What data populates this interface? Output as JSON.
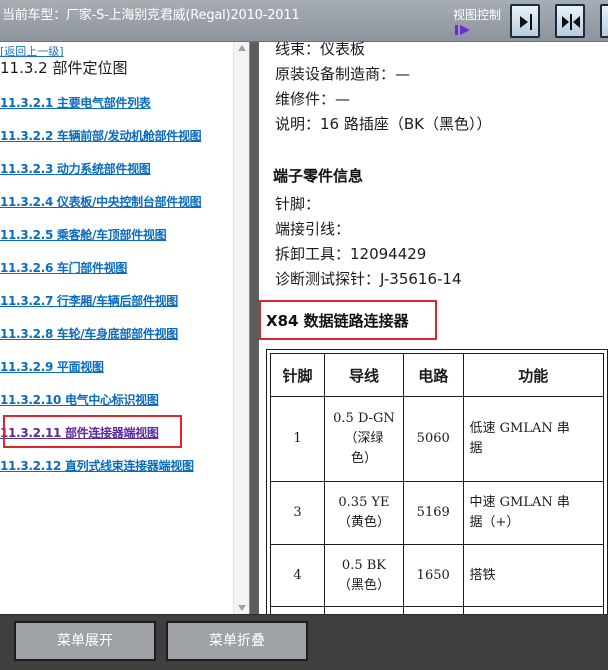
{
  "header": {
    "vehicle_label": "当前车型：厂家-S-上海别克君威(Regal)2010-2011",
    "view_control_label": "视图控制"
  },
  "sidebar": {
    "back_link": "[返回上一级]",
    "section_title": "11.3.2 部件定位图",
    "items": [
      {
        "label": "11.3.2.1 主要电气部件列表"
      },
      {
        "label": "11.3.2.2 车辆前部/发动机舱部件视图"
      },
      {
        "label": "11.3.2.3 动力系统部件视图"
      },
      {
        "label": "11.3.2.4 仪表板/中央控制台部件视图"
      },
      {
        "label": "11.3.2.5 乘客舱/车顶部件视图"
      },
      {
        "label": "11.3.2.6 车门部件视图"
      },
      {
        "label": "11.3.2.7 行李厢/车辆后部件视图"
      },
      {
        "label": "11.3.2.8 车轮/车身底部部件视图"
      },
      {
        "label": "11.3.2.9 平面视图"
      },
      {
        "label": "11.3.2.10 电气中心标识视图"
      },
      {
        "label": "11.3.2.11 部件连接器端视图"
      },
      {
        "label": "11.3.2.12 直列式线束连接器端视图"
      }
    ]
  },
  "content": {
    "info_lines": [
      "线束：仪表板",
      "原装设备制造商：—",
      "维修件：—",
      "说明：16 路插座（BK（黑色））"
    ],
    "terminal_heading": "端子零件信息",
    "terminal_lines": [
      "针脚：",
      "端接引线：",
      "拆卸工具：12094429",
      "诊断测试探针：J-35616-14"
    ],
    "connector_title": "X84 数据链路连接器",
    "table": {
      "headers": [
        "针脚",
        "导线",
        "电路",
        "功能"
      ],
      "rows": [
        {
          "pin": "1",
          "wire_1": "0.5 D-GN",
          "wire_2": "（深绿",
          "wire_3": "色）",
          "circuit": "5060",
          "func_1": "低速 GMLAN 串",
          "func_2": "据"
        },
        {
          "pin": "3",
          "wire_1": "0.35 YE",
          "wire_2": "（黄色）",
          "wire_3": "",
          "circuit": "5169",
          "func_1": "中速 GMLAN 串",
          "func_2": "据（+）"
        },
        {
          "pin": "4",
          "wire_1": "0.5 BK",
          "wire_2": "（黑色）",
          "wire_3": "",
          "circuit": "1650",
          "func_1": "搭铁",
          "func_2": ""
        }
      ]
    }
  },
  "footer": {
    "expand_label": "菜单展开",
    "collapse_label": "菜单折叠"
  },
  "colors": {
    "highlight": "#e0262b",
    "link": "#0b6bbf",
    "visited_link": "#5a2aa0"
  }
}
